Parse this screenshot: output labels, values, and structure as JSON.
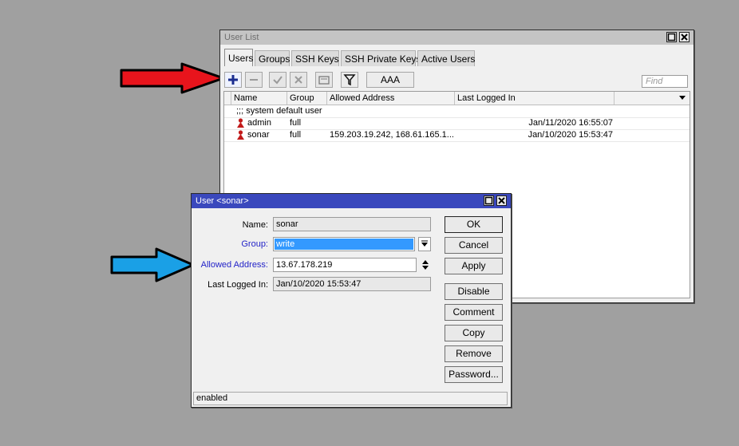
{
  "user_list": {
    "title": "User List",
    "tabs": [
      "Users",
      "Groups",
      "SSH Keys",
      "SSH Private Keys",
      "Active Users"
    ],
    "toolbar": {
      "aaa_label": "AAA",
      "find_placeholder": "Find"
    },
    "columns": [
      "Name",
      "Group",
      "Allowed Address",
      "Last Logged In"
    ],
    "comment_row": ";;; system default user",
    "rows": [
      {
        "name": "admin",
        "group": "full",
        "allowed_address": "",
        "last_logged_in": "Jan/11/2020 16:55:07"
      },
      {
        "name": "sonar",
        "group": "full",
        "allowed_address": "159.203.19.242, 168.61.165.1...",
        "last_logged_in": "Jan/10/2020 15:53:47"
      }
    ]
  },
  "user_dialog": {
    "title": "User <sonar>",
    "fields": {
      "name_label": "Name:",
      "name_value": "sonar",
      "group_label": "Group:",
      "group_value": "write",
      "allowed_label": "Allowed Address:",
      "allowed_value": "13.67.178.219",
      "logged_label": "Last Logged In:",
      "logged_value": "Jan/10/2020 15:53:47"
    },
    "buttons": {
      "ok": "OK",
      "cancel": "Cancel",
      "apply": "Apply",
      "disable": "Disable",
      "comment": "Comment",
      "copy": "Copy",
      "remove": "Remove",
      "password": "Password..."
    },
    "status": "enabled"
  },
  "colors": {
    "red_arrow": "#e8141c",
    "blue_arrow": "#1aa0e6",
    "active_titlebar": "#3a48bd",
    "user_icon": "#c21a1a"
  }
}
